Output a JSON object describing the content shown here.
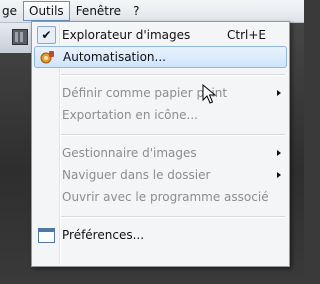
{
  "menubar": {
    "items": [
      "ge",
      "Outils",
      "Fenêtre",
      "?"
    ]
  },
  "menu": {
    "items": [
      {
        "label": "Explorateur d'images",
        "shortcut": "Ctrl+E",
        "checked": true,
        "icon": "check-icon"
      },
      {
        "label": "Automatisation...",
        "highlighted": true,
        "icon": "automation-icon"
      },
      {
        "label": "Définir comme papier peint",
        "disabled": true,
        "submenu": true
      },
      {
        "label": "Exportation en icône...",
        "disabled": true
      },
      {
        "label": "Gestionnaire d'images",
        "disabled": true,
        "submenu": true
      },
      {
        "label": "Naviguer dans le dossier",
        "disabled": true,
        "submenu": true
      },
      {
        "label": "Ouvrir avec le programme associé",
        "disabled": true
      },
      {
        "label": "Préférences...",
        "icon": "preferences-icon"
      }
    ]
  },
  "colors": {
    "highlight_border": "#8fb5e3",
    "disabled_text": "#8d8d8d",
    "menu_bg": "#f4f5f7"
  }
}
